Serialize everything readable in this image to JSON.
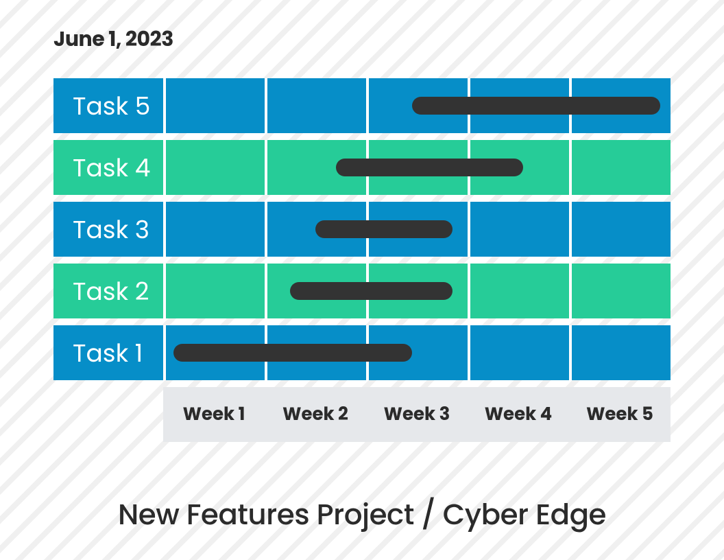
{
  "date": "June 1, 2023",
  "footer_title": "New Features Project / Cyber Edge",
  "colors": {
    "blue": "#068ec8",
    "green": "#26cc98",
    "bar": "#333333",
    "axis_bg": "#e6e8eb"
  },
  "chart_data": {
    "type": "bar",
    "title": "New Features Project / Cyber Edge",
    "xlabel": "",
    "ylabel": "",
    "categories": [
      "Week 1",
      "Week 2",
      "Week 3",
      "Week 4",
      "Week 5"
    ],
    "xlim": [
      0,
      5
    ],
    "series": [
      {
        "name": "Task 5",
        "start": 2.45,
        "end": 4.9,
        "row_color": "blue"
      },
      {
        "name": "Task 4",
        "start": 1.7,
        "end": 3.55,
        "row_color": "green"
      },
      {
        "name": "Task 3",
        "start": 1.5,
        "end": 2.85,
        "row_color": "blue"
      },
      {
        "name": "Task 2",
        "start": 1.25,
        "end": 2.85,
        "row_color": "green"
      },
      {
        "name": "Task 1",
        "start": 0.1,
        "end": 2.45,
        "row_color": "blue"
      }
    ]
  }
}
